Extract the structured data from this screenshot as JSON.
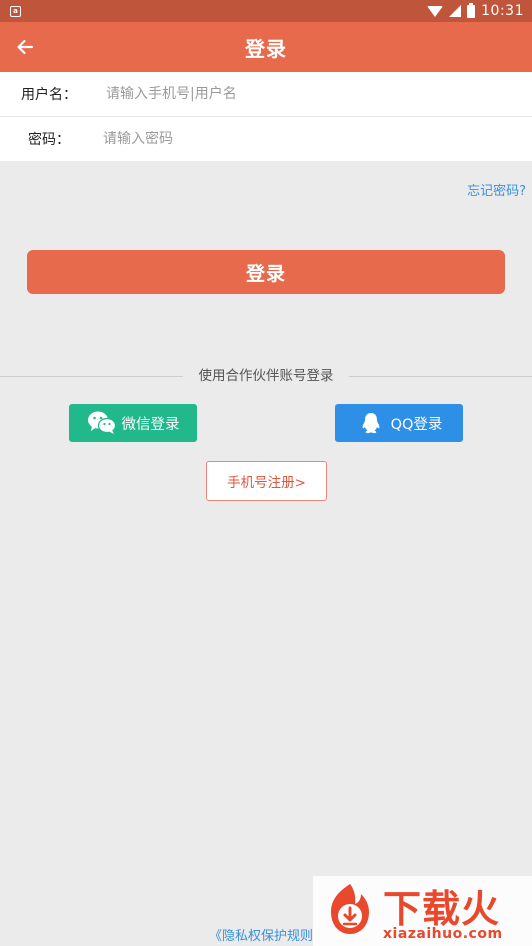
{
  "status_bar": {
    "time": "10:31",
    "notification_icon": "a",
    "icons": [
      "notification-icon",
      "wifi-icon",
      "signal-icon",
      "battery-icon"
    ]
  },
  "app_bar": {
    "title": "登录",
    "back_icon": "arrow-left-icon",
    "color": "#e66a4b"
  },
  "form": {
    "username_label": "用户名：",
    "username_placeholder": "请输入手机号|用户名",
    "username_value": "",
    "password_label": "密码：",
    "password_placeholder": "请输入密码",
    "password_value": ""
  },
  "forgot_password": "忘记密码?",
  "login_button": "登录",
  "partner_divider": "使用合作伙伴账号登录",
  "social": {
    "wechat_label": "微信登录",
    "wechat_color": "#21b88b",
    "qq_label": "QQ登录",
    "qq_color": "#2d8fe6"
  },
  "register_button": "手机号注册>",
  "privacy_link": "《隐私权保护规则",
  "watermark": {
    "title": "下载火",
    "url": "xiazaihuo.com"
  }
}
